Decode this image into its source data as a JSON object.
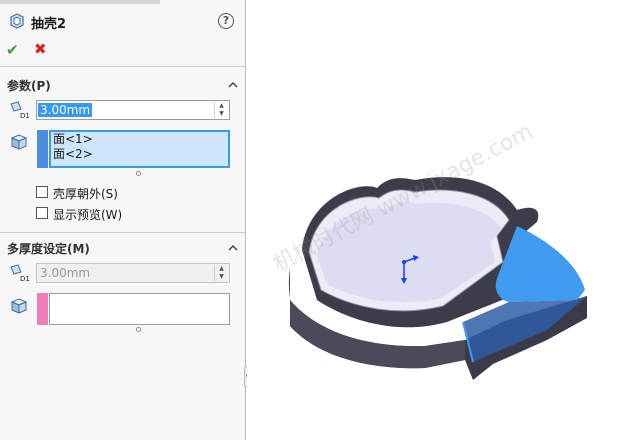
{
  "feature": {
    "title": "抽壳2",
    "help": "?"
  },
  "actions": {
    "ok": "✔",
    "cancel": "✖"
  },
  "parameters": {
    "title": "参数(P)",
    "thickness": "3.00mm",
    "faces": [
      "面<1>",
      "面<2>"
    ],
    "shell_outward": "壳厚朝外(S)",
    "show_preview": "显示预览(W)",
    "selection_color": "#4b8ee0"
  },
  "multi_thickness": {
    "title": "多厚度设定(M)",
    "thickness": "3.00mm",
    "selection_color": "#f07cb8"
  },
  "viewport": {
    "watermark": "机械时代网 www.jxage.com",
    "model_color": "#3c3c4a",
    "floor_color": "#dcdcf2",
    "selected_face_color": "#3e9bf0"
  }
}
